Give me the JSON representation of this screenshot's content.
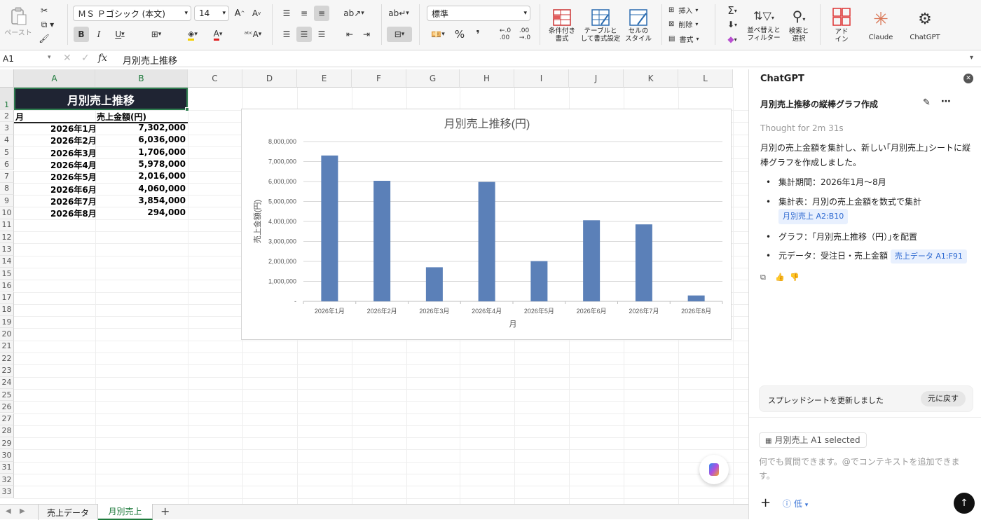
{
  "ribbon": {
    "paste_label": "ペースト",
    "font_name": "ＭＳ Ｐゴシック (本文)",
    "font_size": "14",
    "number_format": "標準",
    "cond_format_label": [
      "条件付き",
      "書式"
    ],
    "table_format_label": [
      "テーブルと",
      "して書式設定"
    ],
    "cell_style_label": [
      "セルの",
      "スタイル"
    ],
    "insert_label": "挿入",
    "delete_label": "削除",
    "format_label": "書式",
    "sort_label": [
      "並べ替えと",
      "フィルター"
    ],
    "find_label": [
      "検索と",
      "選択"
    ],
    "addin_label": [
      "アド",
      "イン"
    ],
    "claude_label": "Claude",
    "chatgpt_label": "ChatGPT"
  },
  "formula_bar": {
    "name_box": "A1",
    "fx": "fx",
    "content": "月別売上推移"
  },
  "grid": {
    "columns": [
      "A",
      "B",
      "C",
      "D",
      "E",
      "F",
      "G",
      "H",
      "I",
      "J",
      "K",
      "L"
    ],
    "rows": [
      "1",
      "2",
      "3",
      "4",
      "5",
      "6",
      "7",
      "8",
      "9",
      "10",
      "11",
      "12",
      "13",
      "14",
      "15",
      "16",
      "17",
      "18",
      "19",
      "20",
      "21",
      "22",
      "23",
      "24",
      "25",
      "26",
      "27",
      "28",
      "29",
      "30",
      "31",
      "32",
      "33"
    ],
    "title": "月別売上推移",
    "header_month": "月",
    "header_amount": "売上金額(円)",
    "data": [
      {
        "month": "2026年1月",
        "amount": "7,302,000"
      },
      {
        "month": "2026年2月",
        "amount": "6,036,000"
      },
      {
        "month": "2026年3月",
        "amount": "1,706,000"
      },
      {
        "month": "2026年4月",
        "amount": "5,978,000"
      },
      {
        "month": "2026年5月",
        "amount": "2,016,000"
      },
      {
        "month": "2026年6月",
        "amount": "4,060,000"
      },
      {
        "month": "2026年7月",
        "amount": "3,854,000"
      },
      {
        "month": "2026年8月",
        "amount": "294,000"
      }
    ]
  },
  "chart_data": {
    "type": "bar",
    "title": "月別売上推移(円)",
    "xlabel": "月",
    "ylabel": "売上金額(円)",
    "categories": [
      "2026年1月",
      "2026年2月",
      "2026年3月",
      "2026年4月",
      "2026年5月",
      "2026年6月",
      "2026年7月",
      "2026年8月"
    ],
    "values": [
      7302000,
      6036000,
      1706000,
      5978000,
      2016000,
      4060000,
      3854000,
      294000
    ],
    "ylim": [
      0,
      8000000
    ],
    "yticks": [
      "-",
      "1,000,000",
      "2,000,000",
      "3,000,000",
      "4,000,000",
      "5,000,000",
      "6,000,000",
      "7,000,000",
      "8,000,000"
    ],
    "bar_color": "#5b80b8",
    "grid": true
  },
  "sheet_tabs": [
    {
      "label": "売上データ"
    },
    {
      "label": "月別売上"
    }
  ],
  "panel": {
    "title": "ChatGPT",
    "conversation_title": "月別売上推移の縦棒グラフ作成",
    "thought": "Thought for 2m 31s",
    "intro": "月別の売上金額を集計し、新しい｢月別売上｣シートに縦棒グラフを作成しました。",
    "bullets": [
      {
        "text": "集計期間：2026年1月〜8月",
        "chip": ""
      },
      {
        "text": "集計表：月別の売上金額を数式で集計",
        "chip": "月別売上 A2:B10"
      },
      {
        "text": "グラフ：｢月別売上推移（円）｣を配置",
        "chip": ""
      },
      {
        "text": "元データ：受注日・売上金額",
        "chip": "売上データ A1:F91"
      }
    ],
    "status": "スプレッドシートを更新しました",
    "undo": "元に戻す",
    "context_chip": "月別売上 A1 selected",
    "input_placeholder": "何でも質問できます。@でコンテキストを追加できます。",
    "effort": "低"
  }
}
